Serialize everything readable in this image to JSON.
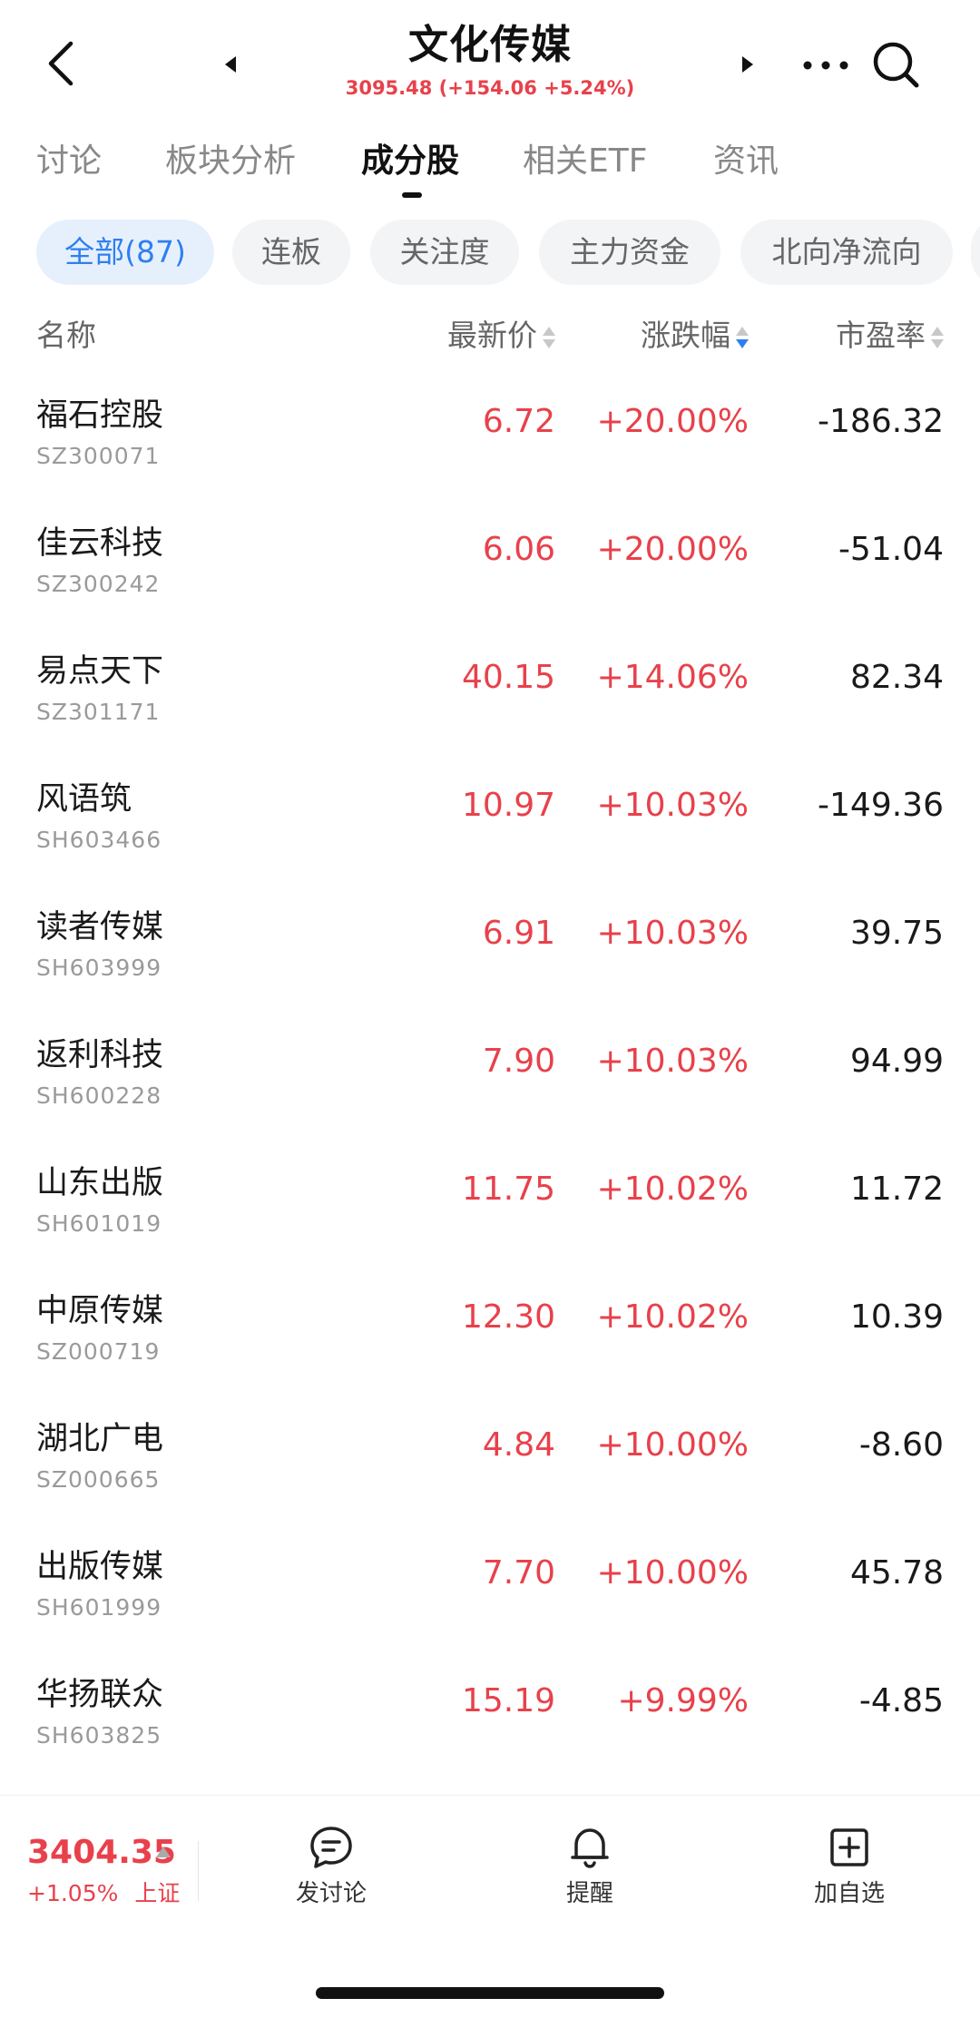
{
  "header": {
    "title": "文化传媒",
    "subtitle": "3095.48 (+154.06 +5.24%)"
  },
  "tabs": [
    {
      "label": "讨论"
    },
    {
      "label": "板块分析"
    },
    {
      "label": "成分股"
    },
    {
      "label": "相关ETF"
    },
    {
      "label": "资讯"
    }
  ],
  "active_tab": "成分股",
  "chips": [
    {
      "label": "全部(87)"
    },
    {
      "label": "连板"
    },
    {
      "label": "关注度"
    },
    {
      "label": "主力资金"
    },
    {
      "label": "北向净流向"
    }
  ],
  "columns": {
    "name": "名称",
    "price": "最新价",
    "change": "涨跌幅",
    "pe": "市盈率"
  },
  "sort_active": "涨跌幅 descending",
  "stocks": [
    {
      "name": "福石控股",
      "code": "SZ300071",
      "price": "6.72",
      "change": "+20.00%",
      "pe": "-186.32"
    },
    {
      "name": "佳云科技",
      "code": "SZ300242",
      "price": "6.06",
      "change": "+20.00%",
      "pe": "-51.04"
    },
    {
      "name": "易点天下",
      "code": "SZ301171",
      "price": "40.15",
      "change": "+14.06%",
      "pe": "82.34"
    },
    {
      "name": "风语筑",
      "code": "SH603466",
      "price": "10.97",
      "change": "+10.03%",
      "pe": "-149.36"
    },
    {
      "name": "读者传媒",
      "code": "SH603999",
      "price": "6.91",
      "change": "+10.03%",
      "pe": "39.75"
    },
    {
      "name": "返利科技",
      "code": "SH600228",
      "price": "7.90",
      "change": "+10.03%",
      "pe": "94.99"
    },
    {
      "name": "山东出版",
      "code": "SH601019",
      "price": "11.75",
      "change": "+10.02%",
      "pe": "11.72"
    },
    {
      "name": "中原传媒",
      "code": "SZ000719",
      "price": "12.30",
      "change": "+10.02%",
      "pe": "10.39"
    },
    {
      "name": "湖北广电",
      "code": "SZ000665",
      "price": "4.84",
      "change": "+10.00%",
      "pe": "-8.60"
    },
    {
      "name": "出版传媒",
      "code": "SH601999",
      "price": "7.70",
      "change": "+10.00%",
      "pe": "45.78"
    },
    {
      "name": "华扬联众",
      "code": "SH603825",
      "price": "15.19",
      "change": "+9.99%",
      "pe": "-4.85"
    }
  ],
  "bottom": {
    "index_value": "3404.35",
    "index_change": "+1.05%",
    "index_name": "上证",
    "actions": [
      {
        "label": "发讨论",
        "icon": "chat-bubble-icon"
      },
      {
        "label": "提醒",
        "icon": "bell-icon"
      },
      {
        "label": "加自选",
        "icon": "plus-square-icon"
      }
    ]
  },
  "colors": {
    "up_red": "#e8414b",
    "accent_blue": "#2f7ff0",
    "chip_bg": "#f3f4f6",
    "chip_active_bg": "#e6f0fd"
  }
}
